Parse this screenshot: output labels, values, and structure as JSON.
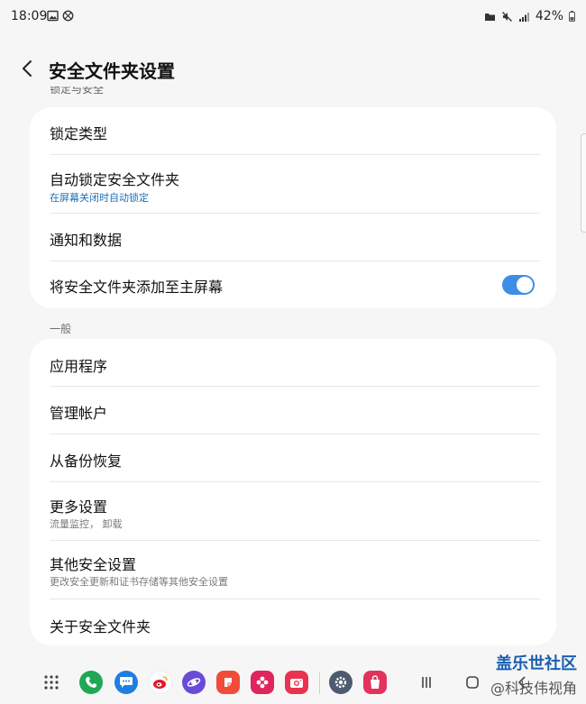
{
  "status_bar": {
    "time": "18:09",
    "battery": "42%"
  },
  "header": {
    "title": "安全文件夹设置"
  },
  "cut_section_label": "锁定与安全",
  "card1": {
    "items": [
      {
        "label": "锁定类型"
      },
      {
        "label": "自动锁定安全文件夹",
        "sub": "在屏幕关闭时自动锁定"
      },
      {
        "label": "通知和数据"
      },
      {
        "label": "将安全文件夹添加至主屏幕",
        "toggle": true
      }
    ]
  },
  "section_general": "一般",
  "card2": {
    "items": [
      {
        "label": "应用程序"
      },
      {
        "label": "管理帐户"
      },
      {
        "label": "从备份恢复"
      },
      {
        "label": "更多设置",
        "sub": "流量监控， 卸载"
      },
      {
        "label": "其他安全设置",
        "sub": "更改安全更新和证书存储等其他安全设置"
      },
      {
        "label": "关于安全文件夹"
      }
    ]
  },
  "colors": {
    "accent": "#3e8ee8",
    "sub_blue": "#1f6fb2",
    "background": "#f6f6f6",
    "card": "#ffffff"
  },
  "taskbar": {
    "icons": [
      "app-drawer-icon",
      "phone-icon",
      "messages-icon",
      "weibo-icon",
      "internet-icon",
      "notes-icon",
      "flower-app-icon",
      "camera-icon",
      "settings-icon",
      "store-icon",
      "recents-icon",
      "home-icon",
      "back-nav-icon"
    ]
  },
  "watermark": {
    "brand": "盖乐世社区",
    "sub": "@科技伟视角"
  }
}
